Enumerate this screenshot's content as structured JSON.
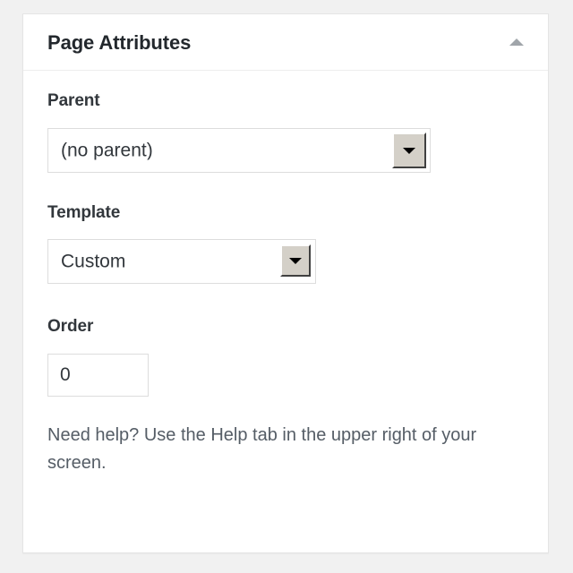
{
  "panel": {
    "title": "Page Attributes",
    "toggle_icon": "caret-up-icon",
    "toggle_state": "expanded"
  },
  "fields": {
    "parent": {
      "label": "Parent",
      "selected": "(no parent)",
      "dropdown_icon": "caret-down-icon"
    },
    "template": {
      "label": "Template",
      "selected": "Custom",
      "dropdown_icon": "caret-down-icon"
    },
    "order": {
      "label": "Order",
      "value": "0",
      "placeholder": "0"
    }
  },
  "help": {
    "text": "Need help? Use the Help tab in the upper right of your screen."
  },
  "colors": {
    "page_background": "#f1f1f1",
    "panel_background": "#ffffff",
    "panel_border": "#e5e5e5",
    "title_text": "#23282d",
    "label_text": "#32373c",
    "help_text": "#555d66",
    "input_border": "#dddddd",
    "button_face": "#d4d0c8",
    "toggle_arrow": "#a0a5aa"
  }
}
